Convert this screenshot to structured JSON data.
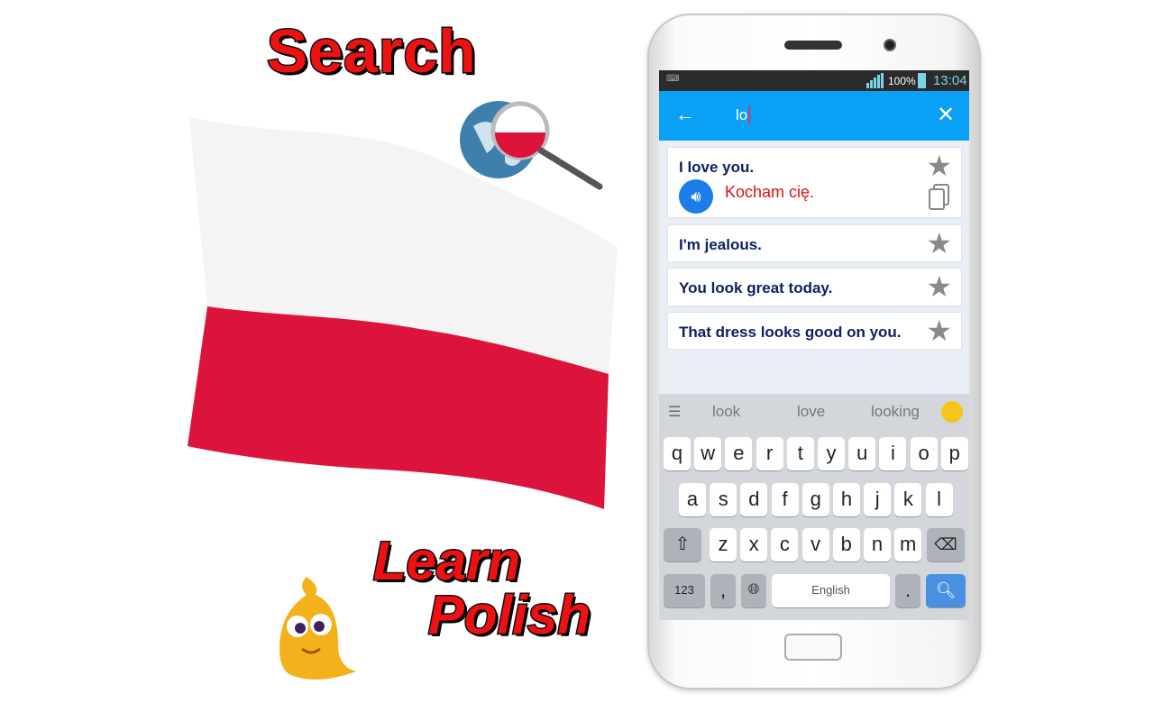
{
  "promo": {
    "title": "Search",
    "learn": "Learn",
    "polish": "Polish"
  },
  "colors": {
    "flag_red": "#dc143c",
    "appbar": "#0aa0f5",
    "english_text": "#102060",
    "polish_text": "#dd1111",
    "search_key": "#4a90e2"
  },
  "status_bar": {
    "battery": "100%",
    "time": "13:04",
    "icons": [
      "keyboard-icon",
      "signal-icon",
      "battery-icon"
    ]
  },
  "search": {
    "value": "lo",
    "back_icon": "arrow-left-icon",
    "clear_icon": "close-icon"
  },
  "results": [
    {
      "english": "I love you.",
      "polish": "Kocham cię.",
      "expanded": true
    },
    {
      "english": "I'm jealous."
    },
    {
      "english": "You look great today."
    },
    {
      "english": "That dress looks good on you."
    }
  ],
  "keyboard": {
    "suggestions": [
      "look",
      "love",
      "looking"
    ],
    "row1": [
      "q",
      "w",
      "e",
      "r",
      "t",
      "y",
      "u",
      "i",
      "o",
      "p"
    ],
    "row2": [
      "a",
      "s",
      "d",
      "f",
      "g",
      "h",
      "j",
      "k",
      "l"
    ],
    "row3": [
      "z",
      "x",
      "c",
      "v",
      "b",
      "n",
      "m"
    ],
    "numbers": "123",
    "comma": ",",
    "space": "English",
    "period": "."
  }
}
